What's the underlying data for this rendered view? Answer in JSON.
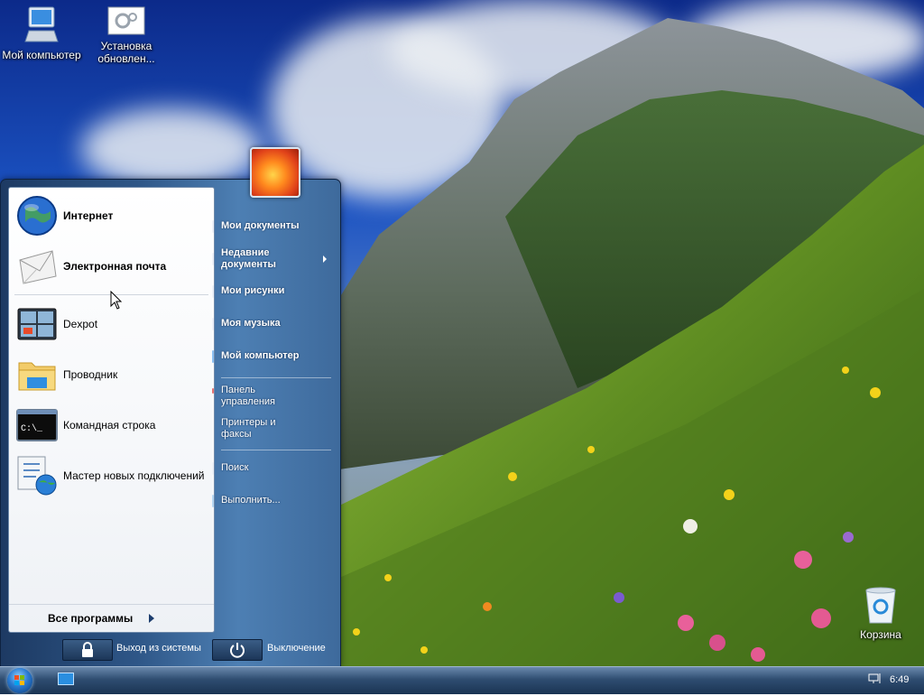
{
  "desktop": {
    "icons": [
      {
        "label": "Мой компьютер"
      },
      {
        "label": "Установка обновлен..."
      },
      {
        "label": "Корзина"
      }
    ]
  },
  "start_menu": {
    "pinned": [
      {
        "label": "Интернет",
        "icon": "globe-icon",
        "bold": true
      },
      {
        "label": "Электронная почта",
        "icon": "envelope-icon",
        "bold": true
      }
    ],
    "recent": [
      {
        "label": "Dexpot",
        "icon": "dexpot-icon"
      },
      {
        "label": "Проводник",
        "icon": "folder-explorer-icon"
      },
      {
        "label": "Командная строка",
        "icon": "command-prompt-icon"
      },
      {
        "label": "Мастер новых подключений",
        "icon": "network-wizard-icon"
      }
    ],
    "all_programs": "Все программы",
    "right": {
      "my_documents": "Мои документы",
      "recent_documents_1": "Недавние",
      "recent_documents_2": "документы",
      "my_pictures": "Мои рисунки",
      "my_music": "Моя музыка",
      "my_computer": "Мой компьютер",
      "control_panel_1": "Панель",
      "control_panel_2": "управления",
      "printers_1": "Принтеры и",
      "printers_2": "факсы",
      "search": "Поиск",
      "run": "Выполнить..."
    },
    "logoff": "Выход из системы",
    "shutdown": "Выключение"
  },
  "taskbar": {
    "clock": "6:49"
  },
  "colors": {
    "start_menu_panel": "#2e5687",
    "taskbar": "#2f4d71"
  }
}
